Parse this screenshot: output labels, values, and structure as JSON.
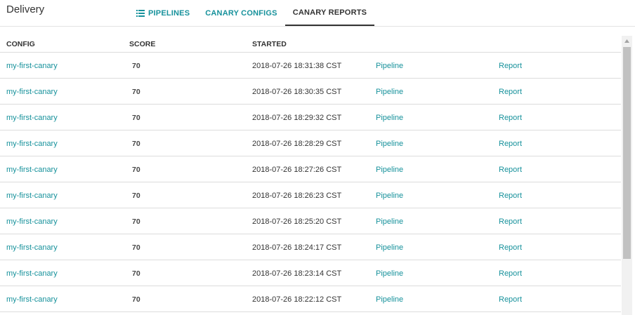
{
  "app": {
    "title": "Delivery"
  },
  "tabs": [
    {
      "label": "PIPELINES",
      "icon": "list-icon"
    },
    {
      "label": "CANARY CONFIGS"
    },
    {
      "label": "CANARY REPORTS",
      "active": true
    }
  ],
  "table": {
    "headers": {
      "config": "CONFIG",
      "score": "SCORE",
      "started": "STARTED"
    },
    "rows": [
      {
        "config": "my-first-canary",
        "score": "70",
        "started": "2018-07-26 18:31:38 CST",
        "pipeline": "Pipeline",
        "report": "Report"
      },
      {
        "config": "my-first-canary",
        "score": "70",
        "started": "2018-07-26 18:30:35 CST",
        "pipeline": "Pipeline",
        "report": "Report"
      },
      {
        "config": "my-first-canary",
        "score": "70",
        "started": "2018-07-26 18:29:32 CST",
        "pipeline": "Pipeline",
        "report": "Report"
      },
      {
        "config": "my-first-canary",
        "score": "70",
        "started": "2018-07-26 18:28:29 CST",
        "pipeline": "Pipeline",
        "report": "Report"
      },
      {
        "config": "my-first-canary",
        "score": "70",
        "started": "2018-07-26 18:27:26 CST",
        "pipeline": "Pipeline",
        "report": "Report"
      },
      {
        "config": "my-first-canary",
        "score": "70",
        "started": "2018-07-26 18:26:23 CST",
        "pipeline": "Pipeline",
        "report": "Report"
      },
      {
        "config": "my-first-canary",
        "score": "70",
        "started": "2018-07-26 18:25:20 CST",
        "pipeline": "Pipeline",
        "report": "Report"
      },
      {
        "config": "my-first-canary",
        "score": "70",
        "started": "2018-07-26 18:24:17 CST",
        "pipeline": "Pipeline",
        "report": "Report"
      },
      {
        "config": "my-first-canary",
        "score": "70",
        "started": "2018-07-26 18:23:14 CST",
        "pipeline": "Pipeline",
        "report": "Report"
      },
      {
        "config": "my-first-canary",
        "score": "70",
        "started": "2018-07-26 18:22:12 CST",
        "pipeline": "Pipeline",
        "report": "Report"
      }
    ]
  },
  "colors": {
    "accent": "#16919b",
    "text": "#333333",
    "border": "#dcdcdc"
  }
}
